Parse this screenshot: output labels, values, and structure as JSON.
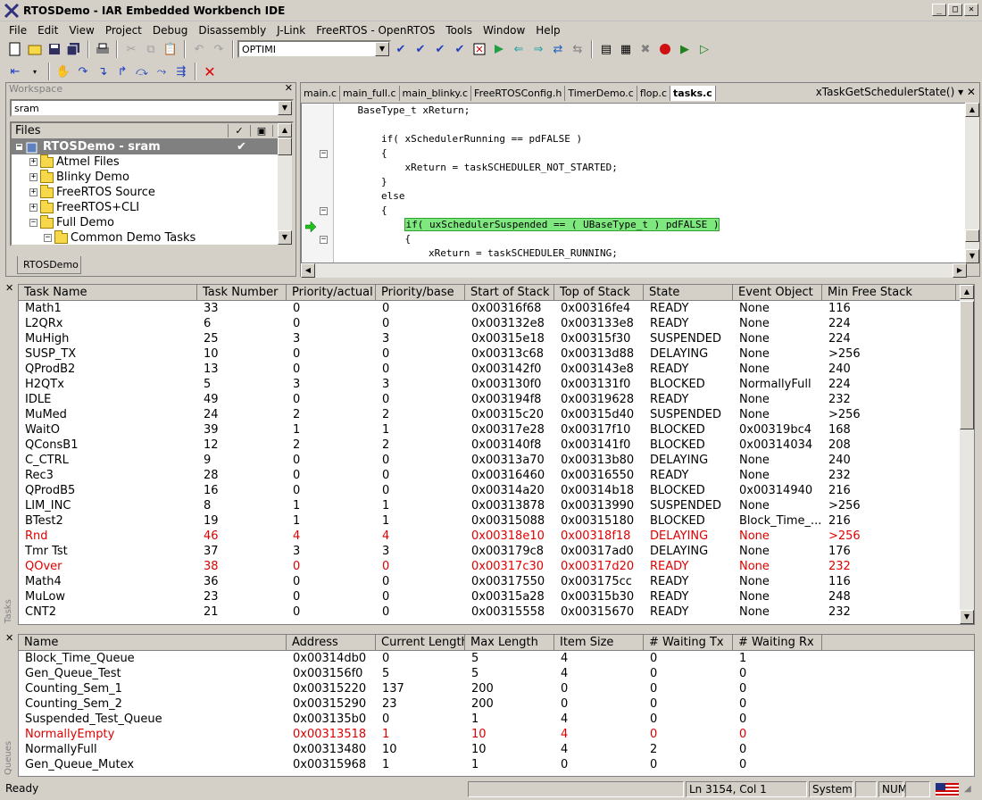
{
  "window": {
    "title": "RTOSDemo - IAR Embedded Workbench IDE"
  },
  "menu": [
    "File",
    "Edit",
    "View",
    "Project",
    "Debug",
    "Disassembly",
    "J-Link",
    "FreeRTOS - OpenRTOS",
    "Tools",
    "Window",
    "Help"
  ],
  "toolbar": {
    "combo_value": "OPTIMI"
  },
  "workspace": {
    "header": "Workspace",
    "config": "sram",
    "files_label": "Files",
    "tab": "RTOSDemo",
    "tree": [
      {
        "label": "RTOSDemo - sram",
        "level": 0,
        "selected": true,
        "check": "✔"
      },
      {
        "label": "Atmel Files",
        "level": 1
      },
      {
        "label": "Blinky Demo",
        "level": 1
      },
      {
        "label": "FreeRTOS Source",
        "level": 1
      },
      {
        "label": "FreeRTOS+CLI",
        "level": 1
      },
      {
        "label": "Full Demo",
        "level": 1
      },
      {
        "label": "Common Demo Tasks",
        "level": 2
      }
    ]
  },
  "editor": {
    "tabs": [
      "main.c",
      "main_full.c",
      "main_blinky.c",
      "FreeRTOSConfig.h",
      "TimerDemo.c",
      "flop.c",
      "tasks.c"
    ],
    "active_tab": "tasks.c",
    "function": "xTaskGetSchedulerState()",
    "lines": [
      "    BaseType_t xReturn;",
      "",
      "        if( xSchedulerRunning == pdFALSE )",
      "        {",
      "            xReturn = taskSCHEDULER_NOT_STARTED;",
      "        }",
      "        else",
      "        {",
      "            if( uxSchedulerSuspended == ( UBaseType_t ) pdFALSE )",
      "            {",
      "                xReturn = taskSCHEDULER_RUNNING;"
    ]
  },
  "tasks": {
    "side_label": "Tasks",
    "columns": [
      "Task Name",
      "Task Number",
      "Priority/actual",
      "Priority/base",
      "Start of Stack",
      "Top of Stack",
      "State",
      "Event Object",
      "Min Free Stack"
    ],
    "rows": [
      [
        "Math1",
        "33",
        "0",
        "0",
        "0x00316f68",
        "0x00316fe4",
        "READY",
        "None",
        "116"
      ],
      [
        "L2QRx",
        "6",
        "0",
        "0",
        "0x003132e8",
        "0x003133e8",
        "READY",
        "None",
        "224"
      ],
      [
        "MuHigh",
        "25",
        "3",
        "3",
        "0x00315e18",
        "0x00315f30",
        "SUSPENDED",
        "None",
        "224"
      ],
      [
        "SUSP_TX",
        "10",
        "0",
        "0",
        "0x00313c68",
        "0x00313d88",
        "DELAYING",
        "None",
        ">256"
      ],
      [
        "QProdB2",
        "13",
        "0",
        "0",
        "0x003142f0",
        "0x003143e8",
        "READY",
        "None",
        "240"
      ],
      [
        "H2QTx",
        "5",
        "3",
        "3",
        "0x003130f0",
        "0x003131f0",
        "BLOCKED",
        "NormallyFull",
        "224"
      ],
      [
        "IDLE",
        "49",
        "0",
        "0",
        "0x003194f8",
        "0x00319628",
        "READY",
        "None",
        "232"
      ],
      [
        "MuMed",
        "24",
        "2",
        "2",
        "0x00315c20",
        "0x00315d40",
        "SUSPENDED",
        "None",
        ">256"
      ],
      [
        "WaitO",
        "39",
        "1",
        "1",
        "0x00317e28",
        "0x00317f10",
        "BLOCKED",
        "0x00319bc4",
        "168"
      ],
      [
        "QConsB1",
        "12",
        "2",
        "2",
        "0x003140f8",
        "0x003141f0",
        "BLOCKED",
        "0x00314034",
        "208"
      ],
      [
        "C_CTRL",
        "9",
        "0",
        "0",
        "0x00313a70",
        "0x00313b80",
        "DELAYING",
        "None",
        "240"
      ],
      [
        "Rec3",
        "28",
        "0",
        "0",
        "0x00316460",
        "0x00316550",
        "READY",
        "None",
        "232"
      ],
      [
        "QProdB5",
        "16",
        "0",
        "0",
        "0x00314a20",
        "0x00314b18",
        "BLOCKED",
        "0x00314940",
        "216"
      ],
      [
        "LIM_INC",
        "8",
        "1",
        "1",
        "0x00313878",
        "0x00313990",
        "SUSPENDED",
        "None",
        ">256"
      ],
      [
        "BTest2",
        "19",
        "1",
        "1",
        "0x00315088",
        "0x00315180",
        "BLOCKED",
        "Block_Time_...",
        "216"
      ],
      [
        "Rnd",
        "46",
        "4",
        "4",
        "0x00318e10",
        "0x00318f18",
        "DELAYING",
        "None",
        ">256"
      ],
      [
        "Tmr Tst",
        "37",
        "3",
        "3",
        "0x003179c8",
        "0x00317ad0",
        "DELAYING",
        "None",
        "176"
      ],
      [
        "QOver",
        "38",
        "0",
        "0",
        "0x00317c30",
        "0x00317d20",
        "READY",
        "None",
        "232"
      ],
      [
        "Math4",
        "36",
        "0",
        "0",
        "0x00317550",
        "0x003175cc",
        "READY",
        "None",
        "116"
      ],
      [
        "MuLow",
        "23",
        "0",
        "0",
        "0x00315a28",
        "0x00315b30",
        "READY",
        "None",
        "248"
      ],
      [
        "CNT2",
        "21",
        "0",
        "0",
        "0x00315558",
        "0x00315670",
        "READY",
        "None",
        "232"
      ]
    ],
    "red_rows": [
      15,
      17
    ]
  },
  "queues": {
    "side_label": "Queues",
    "columns": [
      "Name",
      "Address",
      "Current Length",
      "Max Length",
      "Item Size",
      "# Waiting Tx",
      "# Waiting Rx"
    ],
    "rows": [
      [
        "Block_Time_Queue",
        "0x00314db0",
        "0",
        "5",
        "4",
        "0",
        "1"
      ],
      [
        "Gen_Queue_Test",
        "0x003156f0",
        "5",
        "5",
        "4",
        "0",
        "0"
      ],
      [
        "Counting_Sem_1",
        "0x00315220",
        "137",
        "200",
        "0",
        "0",
        "0"
      ],
      [
        "Counting_Sem_2",
        "0x00315290",
        "23",
        "200",
        "0",
        "0",
        "0"
      ],
      [
        "Suspended_Test_Queue",
        "0x003135b0",
        "0",
        "1",
        "4",
        "0",
        "0"
      ],
      [
        "NormallyEmpty",
        "0x00313518",
        "1",
        "10",
        "4",
        "0",
        "0"
      ],
      [
        "NormallyFull",
        "0x00313480",
        "10",
        "10",
        "4",
        "2",
        "0"
      ],
      [
        "Gen_Queue_Mutex",
        "0x00315968",
        "1",
        "1",
        "0",
        "0",
        "0"
      ]
    ],
    "red_rows": [
      5
    ]
  },
  "status": {
    "left": "Ready",
    "position": "Ln 3154, Col 1",
    "mode": "System",
    "num": "NUM"
  },
  "colors": {
    "highlight": "#7ee87e",
    "error": "#e00000",
    "chrome": "#d4d0c8"
  }
}
